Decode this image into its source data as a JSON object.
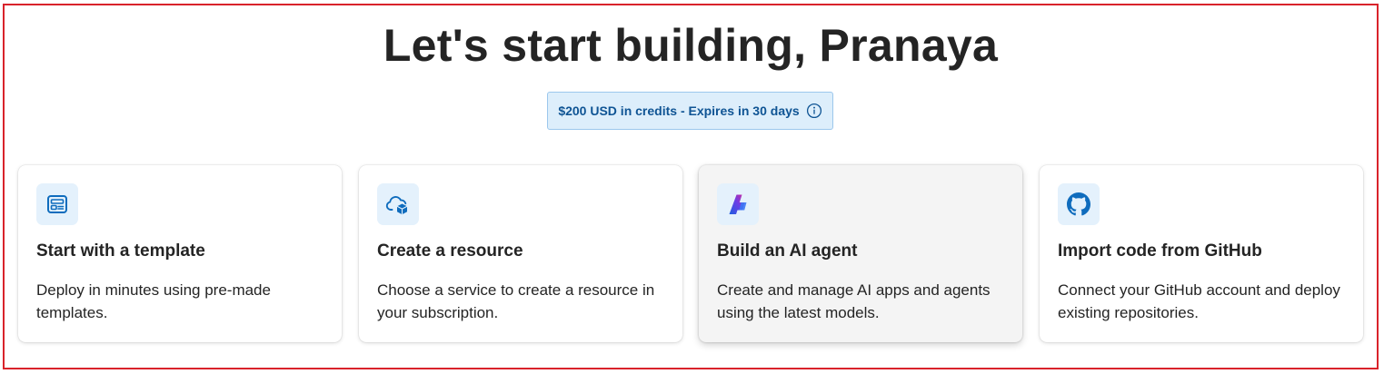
{
  "page": {
    "greeting": "Let's start building, Pranaya"
  },
  "credits_banner": {
    "text": "$200 USD in credits - Expires in 30 days",
    "icon": "info-icon"
  },
  "cards": [
    {
      "icon": "template-icon",
      "title": "Start with a template",
      "description": "Deploy in minutes using pre-made templates."
    },
    {
      "icon": "cloud-resource-icon",
      "title": "Create a resource",
      "description": "Choose a service to create a resource in your subscription."
    },
    {
      "icon": "ai-foundry-icon",
      "title": "Build an AI agent",
      "description": "Create and manage AI apps and agents using the latest models."
    },
    {
      "icon": "github-icon",
      "title": "Import code from GitHub",
      "description": "Connect your GitHub account and deploy existing repositories."
    }
  ],
  "colors": {
    "frame_border": "#d9232b",
    "banner_bg": "#ddeefb",
    "banner_text": "#0f5494",
    "icon_bg": "#e4f1fc",
    "icon_blue": "#0f6cbd"
  }
}
